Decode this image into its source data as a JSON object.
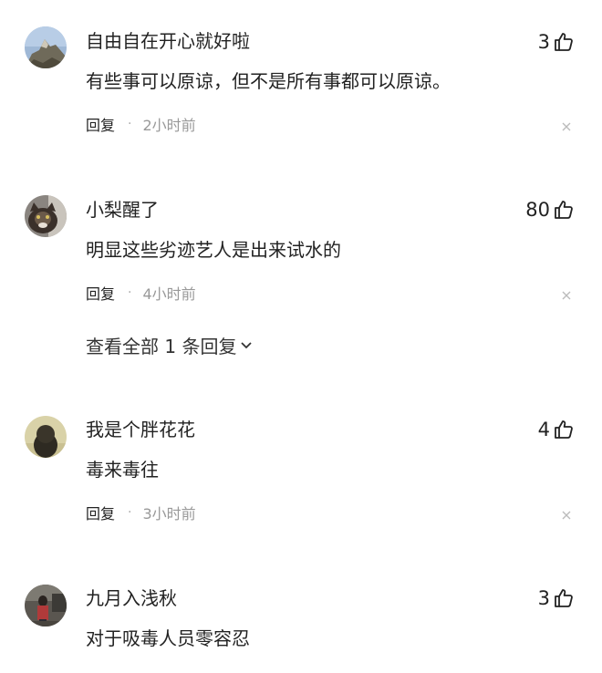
{
  "comments": [
    {
      "username": "自由自在开心就好啦",
      "likes": "3",
      "text": "有些事可以原谅，但不是所有事都可以原谅。",
      "reply_label": "回复",
      "separator": "·",
      "time": "2小时前"
    },
    {
      "username": "小梨醒了",
      "likes": "80",
      "text": "明显这些劣迹艺人是出来试水的",
      "reply_label": "回复",
      "separator": "·",
      "time": "4小时前"
    },
    {
      "username": "我是个胖花花",
      "likes": "4",
      "text": "毒来毒往",
      "reply_label": "回复",
      "separator": "·",
      "time": "3小时前"
    },
    {
      "username": "九月入浅秋",
      "likes": "3",
      "text": "对于吸毒人员零容忍"
    }
  ],
  "view_all_replies": "查看全部 1 条回复",
  "icons": {
    "like": "thumbs-up-icon",
    "close": "close-icon",
    "expand": "chevron-down-icon"
  },
  "colors": {
    "text": "#222222",
    "meta": "#999999",
    "close": "#bbbbbb"
  }
}
